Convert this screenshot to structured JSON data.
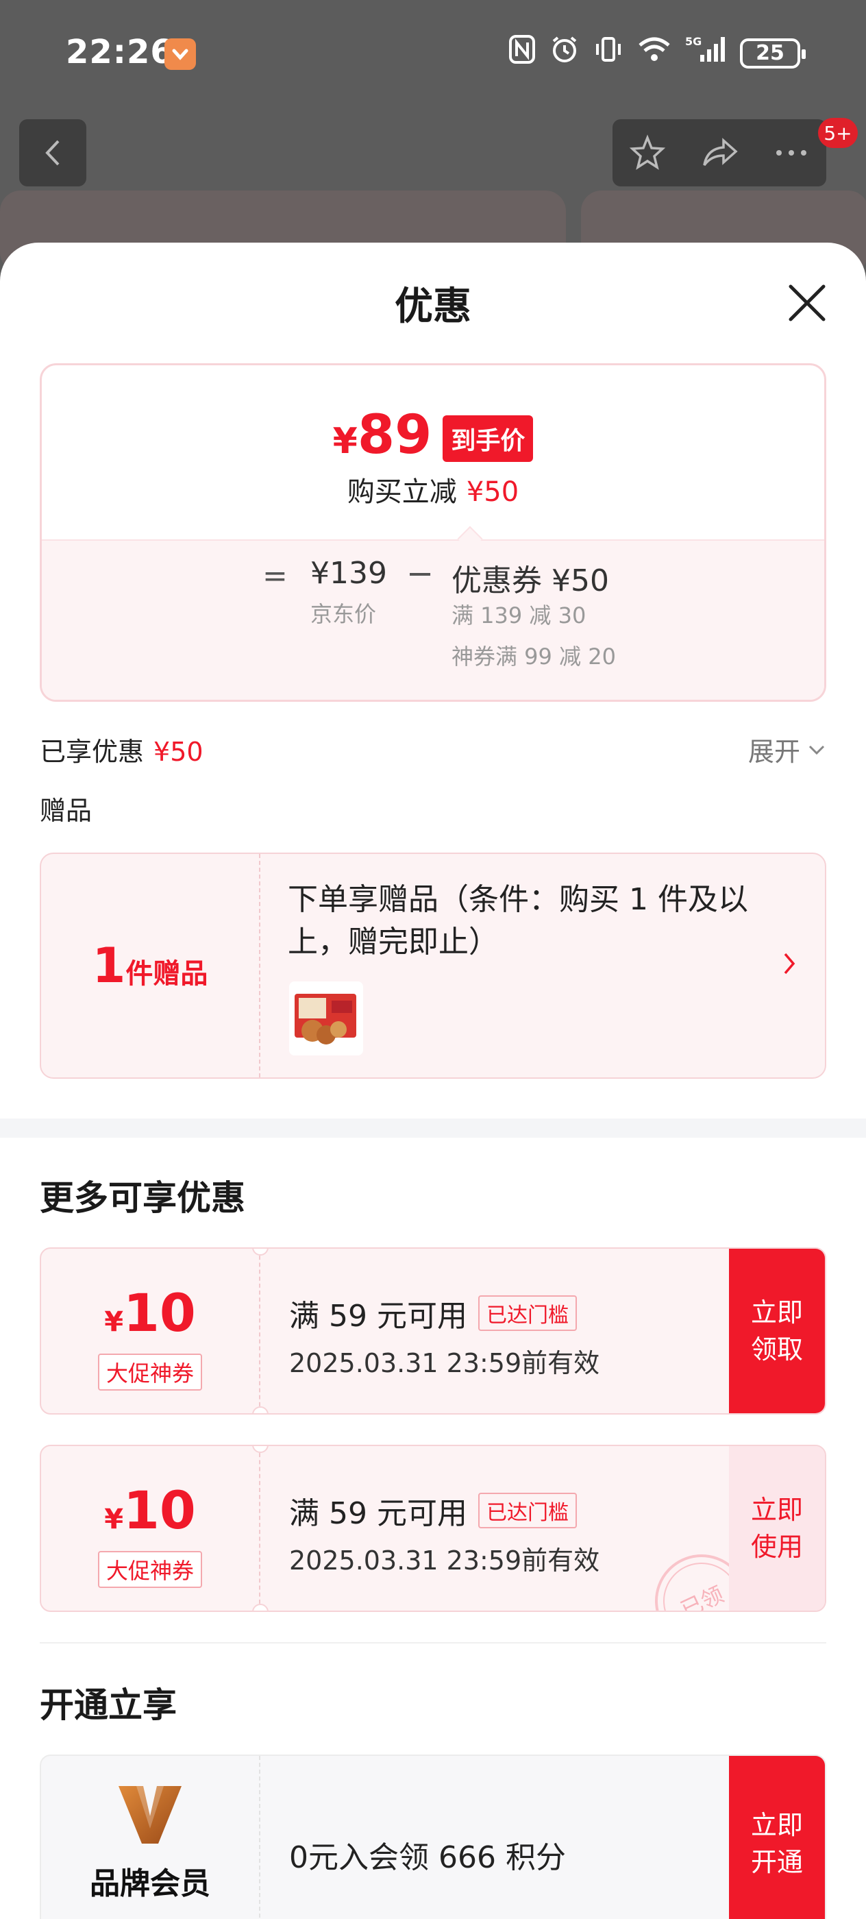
{
  "status_bar": {
    "time": "22:26",
    "battery": "25"
  },
  "sheet": {
    "title": "优惠"
  },
  "price_card": {
    "final_price": "89",
    "currency": "¥",
    "final_tag": "到手价",
    "reduce_label": "购买立减",
    "reduce_value": "¥50",
    "equals": "=",
    "jd_price": "¥139",
    "jd_price_label": "京东价",
    "minus": "−",
    "coupon_total": "优惠券 ¥50",
    "coupon_line1": "满 139 减 30",
    "coupon_line2": "神券满 99 减 20"
  },
  "summary": {
    "enjoyed_label": "已享优惠",
    "enjoyed_value": "¥50",
    "expand_label": "展开",
    "gift_heading": "赠品"
  },
  "gift": {
    "count": "1",
    "count_label": "件赠品",
    "description": "下单享赠品（条件：购买 1 件及以上，赠完即止）"
  },
  "more": {
    "heading": "更多可享优惠",
    "coupons": [
      {
        "currency": "¥",
        "amount": "10",
        "type": "大促神券",
        "condition": "满 59 元可用",
        "badge": "已达门槛",
        "validity": "2025.03.31 23:59前有效",
        "button": "立即领取"
      },
      {
        "currency": "¥",
        "amount": "10",
        "type": "大促神券",
        "condition": "满 59 元可用",
        "badge": "已达门槛",
        "validity": "2025.03.31 23:59前有效",
        "button": "立即使用",
        "stamp": "已领"
      }
    ]
  },
  "membership": {
    "heading": "开通立享",
    "name": "品牌会员",
    "offer": "0元入会领 666 积分",
    "button": "立即开通"
  },
  "background": {
    "badge": "5+"
  },
  "colors": {
    "accent": "#f0192a",
    "card_bg": "#fdf3f4"
  }
}
